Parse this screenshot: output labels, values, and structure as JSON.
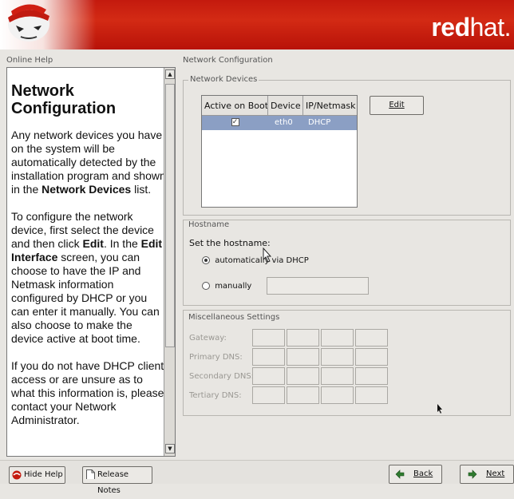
{
  "banner": {
    "brand_bold": "red",
    "brand_light": "hat."
  },
  "help": {
    "section_label": "Online Help",
    "title": "Network Configuration",
    "p1_pre": "Any network devices you have on the system will be automatically detected by the installation program and shown in the ",
    "p1_bold": "Network Devices",
    "p1_post": " list.",
    "p2_a": "To configure the network device, first select the device and then click ",
    "p2_bold1": "Edit",
    "p2_b": ". In the ",
    "p2_bold2": "Edit Interface",
    "p2_c": " screen, you can choose to have the IP and Netmask information configured by DHCP or you can enter it manually. You can also choose to make the device active at boot time.",
    "p3": "If you do not have DHCP client access or are unsure as to what this information is, please contact your Network Administrator."
  },
  "main": {
    "section_label": "Network Configuration",
    "network_devices": {
      "legend": "Network Devices",
      "columns": [
        "Active on Boot",
        "Device",
        "IP/Netmask"
      ],
      "rows": [
        {
          "active": true,
          "device": "eth0",
          "ip": "DHCP"
        }
      ],
      "edit_button": "Edit"
    },
    "hostname": {
      "legend": "Hostname",
      "prompt": "Set the hostname:",
      "option_auto": "automatically via DHCP",
      "option_manual": "manually",
      "selected": "automatically"
    },
    "misc": {
      "legend": "Miscellaneous Settings",
      "labels": [
        "Gateway:",
        "Primary DNS:",
        "Secondary DNS:",
        "Tertiary DNS:"
      ]
    }
  },
  "bottom": {
    "hide_help": "Hide Help",
    "release_notes": "Release Notes",
    "back": "Back",
    "next": "Next"
  }
}
